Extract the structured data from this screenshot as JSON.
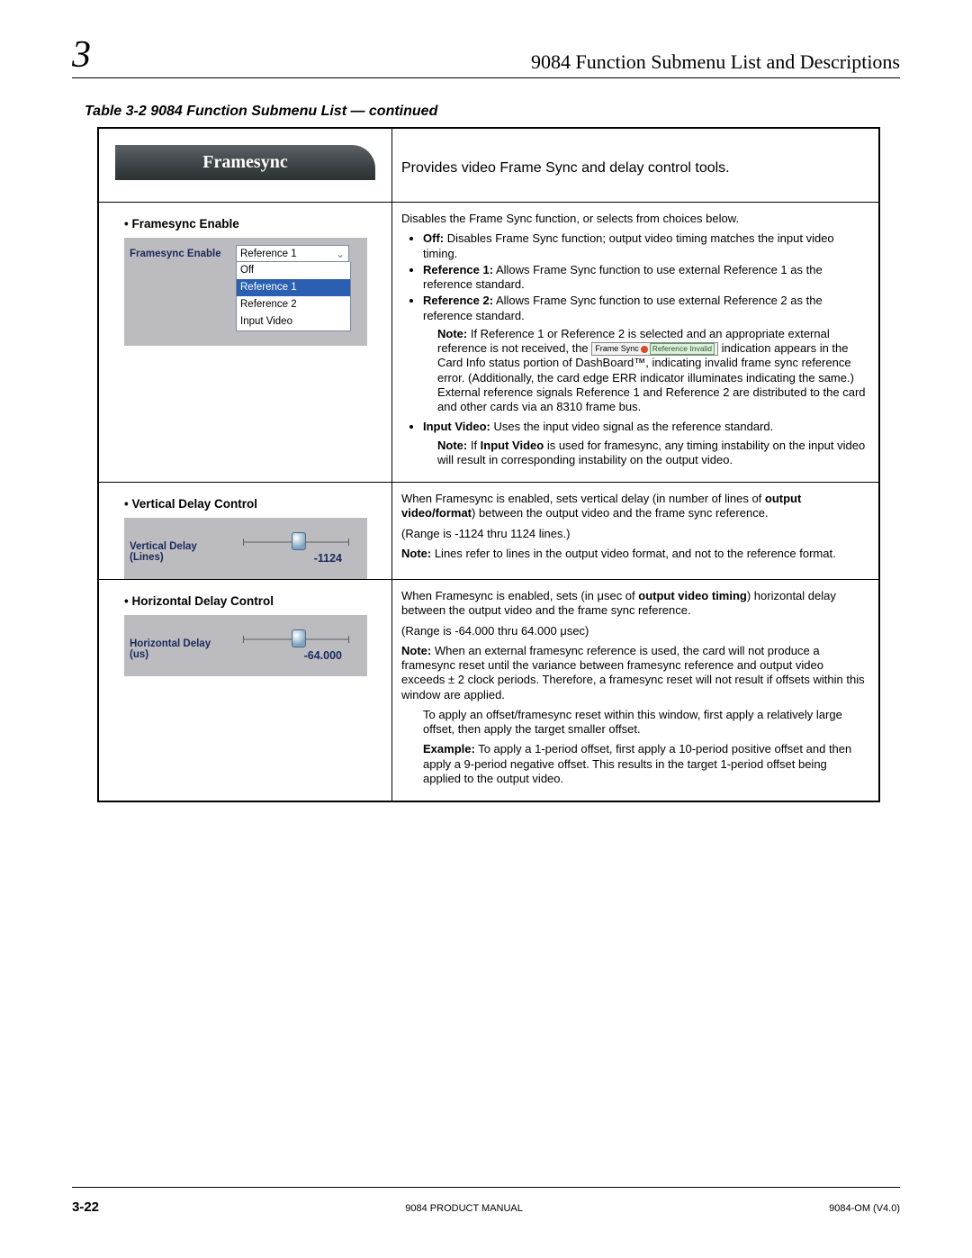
{
  "header": {
    "chapter_number": "3",
    "chapter_title": "9084 Function Submenu List and Descriptions"
  },
  "caption": "Table 3-2    9084 Function Submenu List — continued",
  "tab_title": "Framesync",
  "tab_summary": "Provides video Frame Sync and delay control tools.",
  "row1": {
    "label": "Framesync Enable",
    "ui_label": "Framesync Enable",
    "combo_value": "Reference 1",
    "options": [
      "Off",
      "Reference 1",
      "Reference 2",
      "Input Video"
    ],
    "selected_index": 1,
    "intro": "Disables the Frame Sync function, or selects from choices below.",
    "b_off_t": "Off:",
    "b_off": " Disables Frame Sync function; output video timing matches the input video timing.",
    "b_r1_t": "Reference 1:",
    "b_r1": " Allows Frame Sync function to use external Reference 1 as the reference standard.",
    "b_r2_t": "Reference 2:",
    "b_r2": " Allows Frame Sync function to use external Reference 2 as the reference standard.",
    "r_note_t": "Note:",
    "r_note_a": " If Reference 1 or Reference 2 is selected and an appropriate external reference is not received, the ",
    "badge_fs": "Frame Sync",
    "badge_ref": "Reference Invalid",
    "r_note_b": " indication appears in the Card Info status portion of DashBoard™, indicating invalid frame sync reference error. (Additionally, the card edge ERR indicator illuminates indicating the same.) External reference signals Reference 1 and Reference 2 are distributed to the card and other cards via an 8310 frame bus.",
    "b_iv_t": "Input Video:",
    "b_iv": " Uses the input video signal as the reference standard.",
    "iv_note_t": "Note:",
    "iv_note_a": " If ",
    "iv_note_bold": "Input Video",
    "iv_note_b": " is used for framesync, any timing instability on the input video will result in corresponding instability on the output video."
  },
  "row2": {
    "label": "Vertical Delay Control",
    "ui_label": "Vertical Delay (Lines)",
    "value": "-1124",
    "p1a": "When Framesync is enabled, sets vertical delay (in number of lines of ",
    "p1b": "output video/format",
    "p1c": ") between the output video and the frame sync reference.",
    "p2": "(Range is -1124 thru 1124 lines.)",
    "p3t": "Note:",
    "p3": " Lines refer to lines in the output video format, and not to the reference format."
  },
  "row3": {
    "label": "Horizontal Delay Control",
    "ui_label": "Horizontal Delay (us)",
    "value": "-64.000",
    "p1a": "When Framesync is enabled, sets (in μsec of ",
    "p1b": "output video timing",
    "p1c": ") horizontal delay between the output video and the frame sync reference.",
    "p2": "(Range is -64.000 thru 64.000 μsec)",
    "p3t": "Note:",
    "p3": " When an external framesync reference is used, the card will not produce a framesync reset until the variance between framesync reference and output video exceeds ± 2 clock periods. Therefore, a framesync reset will not result if offsets within this window are applied.",
    "p4": "To apply an offset/framesync reset within this window, first apply a relatively large offset, then apply the target smaller offset.",
    "p5t": "Example:",
    "p5": " To apply a 1-period offset, first apply a 10-period positive offset and then apply a 9-period negative offset. This results in the target 1-period offset being applied to the output video."
  },
  "footer": {
    "page": "3-22",
    "center": "9084 PRODUCT MANUAL",
    "right": "9084-OM  (V4.0)"
  }
}
